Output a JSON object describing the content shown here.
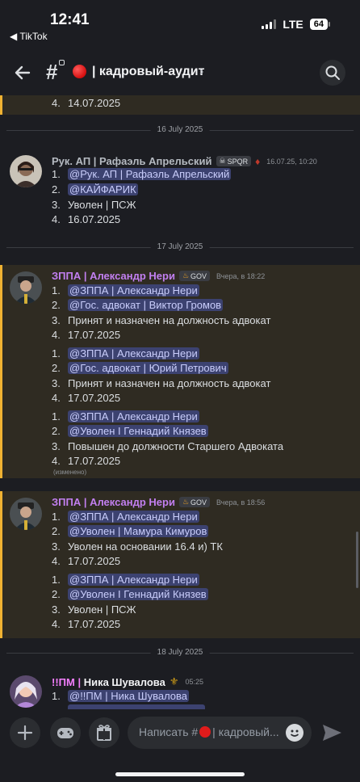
{
  "status": {
    "time": "12:41",
    "back_app": "◀ TikTok",
    "network": "LTE",
    "battery": "64"
  },
  "header": {
    "channel_name": "| кадровый-аудит",
    "chevron": "›"
  },
  "messages": {
    "prev_line": "14.07.2025",
    "date1": "16 July 2025",
    "msg1": {
      "author": "Рук. АП | Рафаэль Апрельский",
      "tag": "SPQR",
      "time": "16.07.25, 10:20",
      "l1": "@Рук. АП | Рафаэль Апрельский",
      "l2": "@КАЙФАРИК",
      "l3": "Уволен | ПСЖ",
      "l4": "16.07.2025"
    },
    "date2": "17 July 2025",
    "msg2": {
      "author": "ЗППА | Александр Нери",
      "tag": "GOV",
      "time": "Вчера, в 18:22",
      "a1": "@ЗППА | Александр Нери",
      "a2": "@Гос. адвокат | Виктор Громов",
      "a3": "Принят и назначен на должность адвокат",
      "a4": "17.07.2025",
      "b1": "@ЗППА | Александр Нери",
      "b2": "@Гос. адвокат | Юрий Петрович",
      "b3": "Принят и назначен на должность адвокат",
      "b4": "17.07.2025",
      "c1": "@ЗППА | Александр Нери",
      "c2": "@Уволен I Геннадий Князев",
      "c3": "Повышен до должности Старшего Адвоката",
      "c4": "17.07.2025",
      "edited": "(изменено)"
    },
    "msg3": {
      "author": "ЗППА | Александр Нери",
      "tag": "GOV",
      "time": "Вчера, в 18:56",
      "a1": "@ЗППА | Александр Нери",
      "a2": "@Уволен | Мамура Кимуров",
      "a3": "Уволен на основании 16.4 и) ТК",
      "a4": "17.07.2025",
      "b1": "@ЗППА | Александр Нери",
      "b2": "@Уволен I Геннадий Князев",
      "b3": "Уволен | ПСЖ",
      "b4": "17.07.2025"
    },
    "date3": "18 July 2025",
    "msg4": {
      "author_prefix": "!!ПМ | ",
      "author_name": "Ника Шувалова",
      "time": "05:25",
      "l1": "@!!ПМ | Ника Шувалова"
    },
    "nums": [
      "1.",
      "2.",
      "3.",
      "4."
    ]
  },
  "composer": {
    "placeholder_prefix": "Написать #",
    "placeholder_suffix": "| кадровый..."
  },
  "colors": {
    "accent_highlight": "#f0b232",
    "mention_bg": "#3c4270",
    "gov_author": "#c27ff0",
    "pm_author": "#f47fff"
  }
}
